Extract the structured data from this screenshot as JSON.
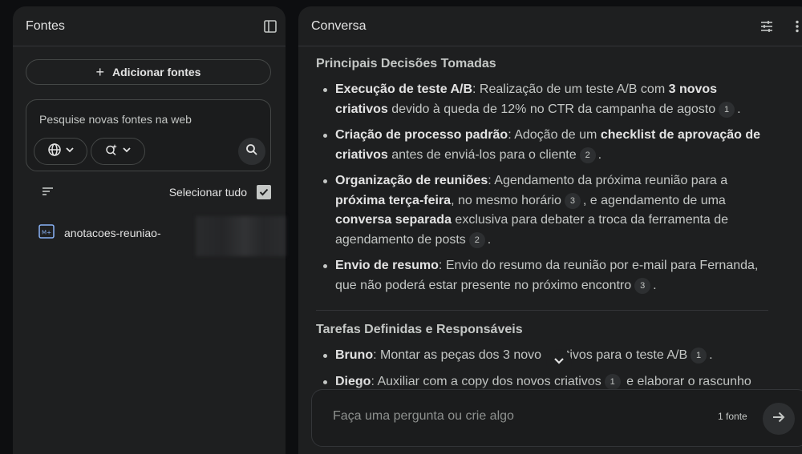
{
  "sources_panel": {
    "title": "Fontes",
    "add_sources_label": "Adicionar fontes",
    "search_placeholder": "Pesquise novas fontes na web",
    "select_all_label": "Selecionar tudo",
    "items": [
      {
        "name": "anotacoes-reuniao-",
        "icon": "markdown-file-icon",
        "checked": true
      }
    ]
  },
  "chat_panel": {
    "title": "Conversa",
    "section1": {
      "title": "Principais Decisões Tomadas",
      "items": [
        {
          "parts": [
            "Execução de teste A/B",
            ": Realização de um teste A/B com ",
            "3 novos criativos",
            " devido à queda de 12% no CTR da campanha de agosto",
            "1",
            "."
          ]
        },
        {
          "parts": [
            "Criação de processo padrão",
            ": Adoção de um ",
            "checklist de aprovação de criativos",
            " antes de enviá-los para o cliente",
            "2",
            "."
          ]
        },
        {
          "parts": [
            "Organização de reuniões",
            ": Agendamento da próxima reunião para a ",
            "próxima terça-feira",
            ", no mesmo horário",
            "3",
            ", e agendamento de uma ",
            "conversa separada",
            " exclusiva para debater a troca da ferramenta de agendamento de posts",
            "2",
            "."
          ]
        },
        {
          "parts": [
            "Envio de resumo",
            ": Envio do resumo da reunião por e-mail para Fernanda, que não poderá estar presente no próximo encontro",
            "3",
            "."
          ]
        }
      ]
    },
    "section2": {
      "title": "Tarefas Definidas e Responsáveis",
      "items": [
        {
          "parts": [
            "Bruno",
            ": Montar as peças dos 3 novo",
            "ativos para o teste A/B",
            "1",
            "."
          ]
        },
        {
          "parts": [
            "Diego",
            ": Auxiliar com a copy dos novos criativos",
            "1",
            " e elaborar o rascunho"
          ]
        }
      ]
    },
    "input_placeholder": "Faça uma pergunta ou crie algo",
    "source_count": "1 fonte"
  },
  "colors": {
    "background": "#0d0e10",
    "panel": "#1e1f20",
    "text_primary": "#e3e3e3",
    "text_secondary": "#c4c7c5",
    "border": "#444746",
    "citation_bg": "#2d2f31"
  }
}
